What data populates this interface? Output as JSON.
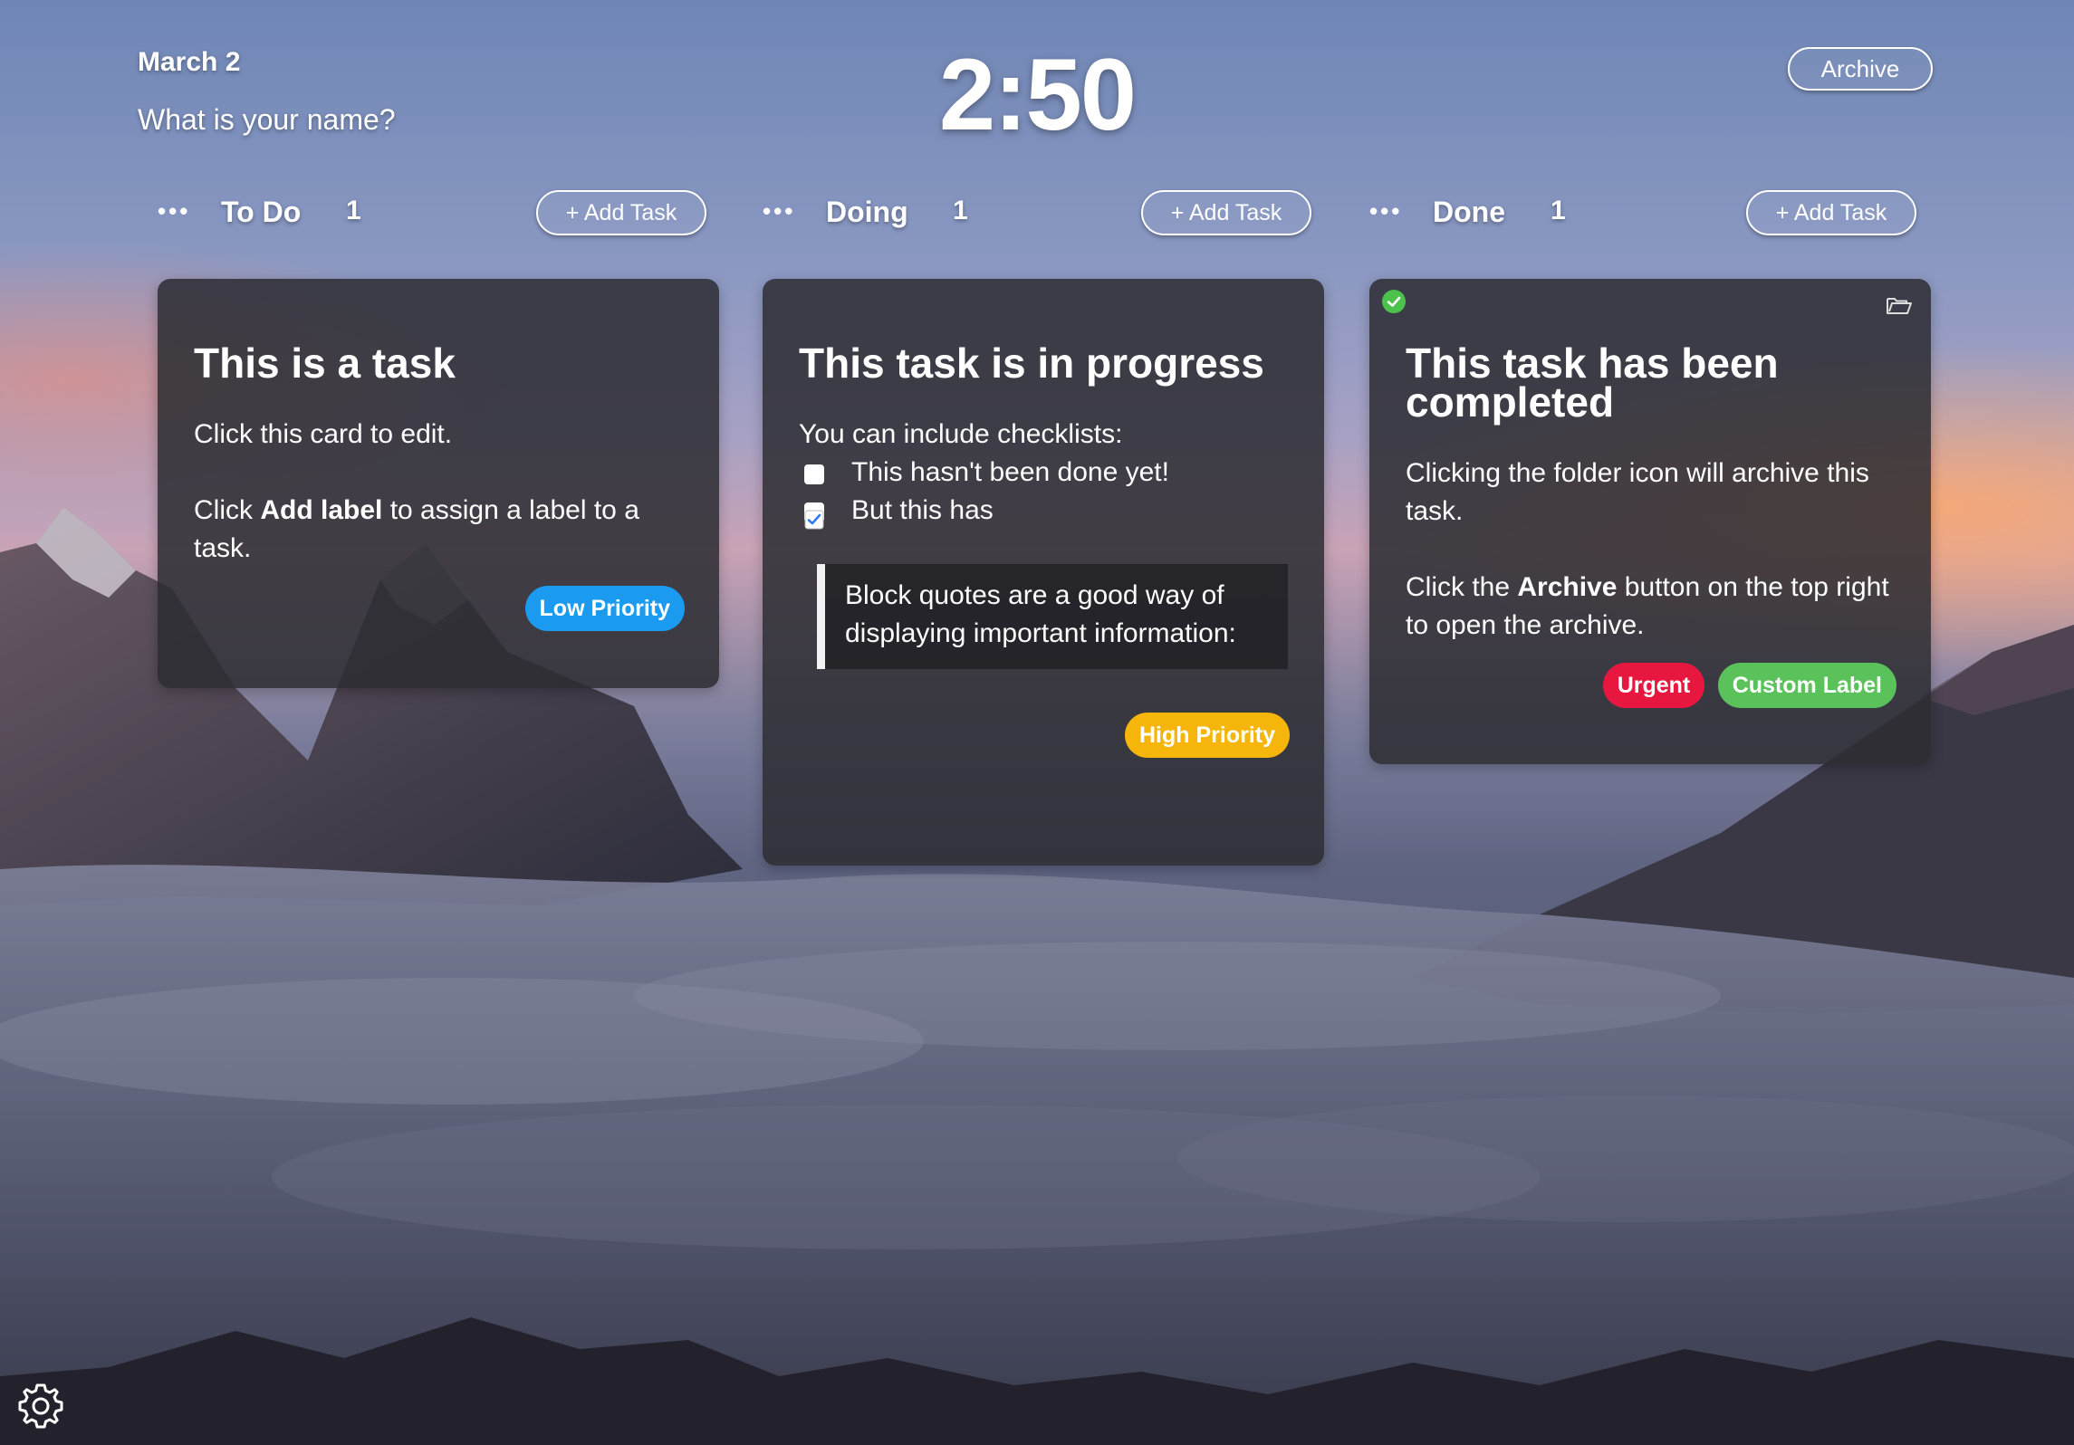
{
  "header": {
    "date": "March 2",
    "greeting": "What is your name?",
    "clock": "2:50",
    "archive_label": "Archive"
  },
  "columns": [
    {
      "menu_icon": "ellipsis-icon",
      "title": "To Do",
      "count": "1",
      "add_label": "+ Add Task"
    },
    {
      "menu_icon": "ellipsis-icon",
      "title": "Doing",
      "count": "1",
      "add_label": "+ Add Task"
    },
    {
      "menu_icon": "ellipsis-icon",
      "title": "Done",
      "count": "1",
      "add_label": "+ Add Task"
    }
  ],
  "cards": {
    "todo": {
      "title": "This is a task",
      "line1": "Click this card to edit.",
      "line2_pre": "Click ",
      "line2_bold": "Add label",
      "line2_post": " to assign a label to a task.",
      "label": "Low Priority",
      "label_color": "#1a9bf0"
    },
    "doing": {
      "title": "This task is in progress",
      "intro": "You can include checklists:",
      "checklist": [
        {
          "text": "This hasn't been done yet!",
          "checked": false
        },
        {
          "text": "But this has",
          "checked": true
        }
      ],
      "quote": "Block quotes are a good way of displaying important information:",
      "label": "High Priority",
      "label_color": "#f5b50b"
    },
    "done": {
      "status_icon": "check-circle-icon",
      "archive_icon": "folder-open-icon",
      "title": "This task has been completed",
      "line1": "Clicking the folder icon will archive this task.",
      "line2_pre": "Click the ",
      "line2_bold": "Archive",
      "line2_post": " button on the top right to open the archive.",
      "labels": [
        {
          "text": "Urgent",
          "color": "#e8173f"
        },
        {
          "text": "Custom Label",
          "color": "#5bc15a"
        }
      ]
    }
  },
  "footer": {
    "settings_icon": "gear-icon"
  },
  "colors": {
    "checkbox_checked": "#2f7cf6",
    "status_green": "#4cc24c"
  }
}
